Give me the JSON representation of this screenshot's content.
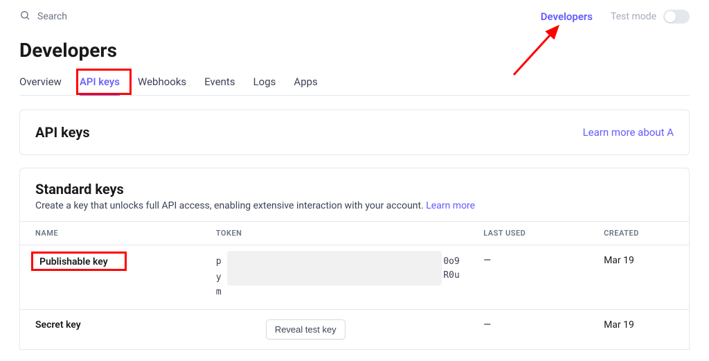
{
  "topbar": {
    "search_placeholder": "Search",
    "developers_link": "Developers",
    "testmode_label": "Test mode"
  },
  "page": {
    "title": "Developers"
  },
  "tabs": [
    {
      "id": "overview",
      "label": "Overview",
      "active": false
    },
    {
      "id": "api-keys",
      "label": "API keys",
      "active": true
    },
    {
      "id": "webhooks",
      "label": "Webhooks",
      "active": false
    },
    {
      "id": "events",
      "label": "Events",
      "active": false
    },
    {
      "id": "logs",
      "label": "Logs",
      "active": false
    },
    {
      "id": "apps",
      "label": "Apps",
      "active": false
    }
  ],
  "card": {
    "title": "API keys",
    "link_text": "Learn more about A"
  },
  "section": {
    "title": "Standard keys",
    "desc_prefix": "Create a key that unlocks full API access, enabling extensive interaction with your account. ",
    "learn_more": "Learn more"
  },
  "table": {
    "headers": {
      "name": "NAME",
      "token": "TOKEN",
      "last_used": "LAST USED",
      "created": "CREATED"
    },
    "rows": [
      {
        "name": "Publishable key",
        "token_prefix": "p",
        "token_trail1": "0o9",
        "token_line2_prefix": "y",
        "token_trail2": "R0u",
        "token_line3_prefix": "m",
        "last_used": "—",
        "created": "Mar 19",
        "highlighted": true
      },
      {
        "name": "Secret key",
        "reveal_label": "Reveal test key",
        "last_used": "—",
        "created": "Mar 19"
      }
    ]
  },
  "colors": {
    "accent": "#635bff",
    "highlight": "#ff0000"
  }
}
